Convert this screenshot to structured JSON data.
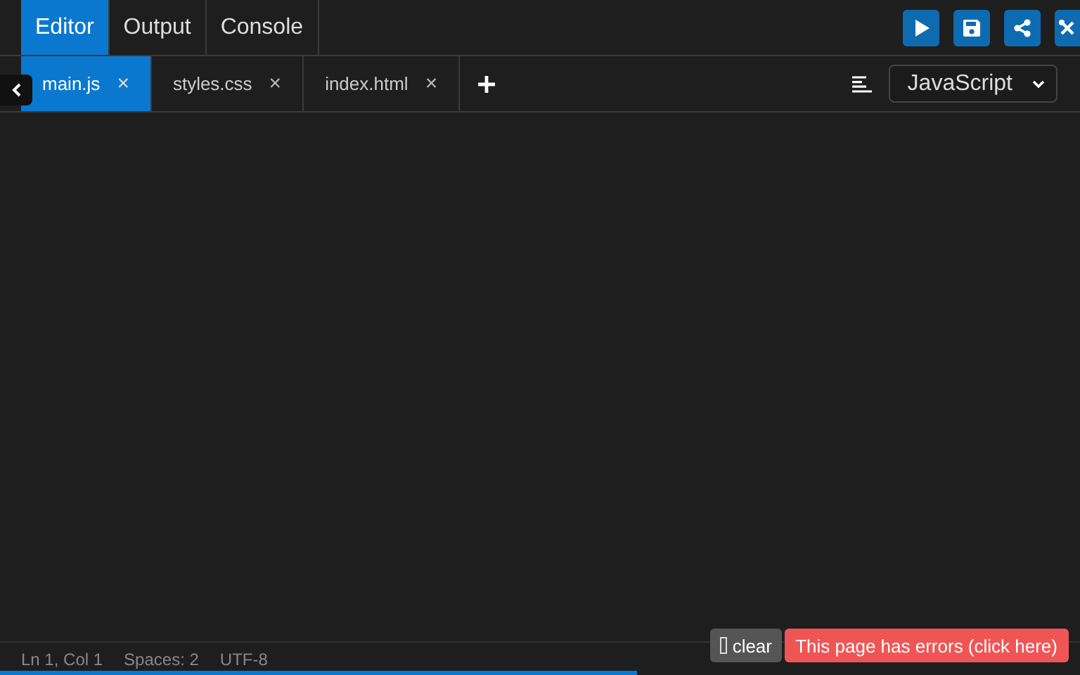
{
  "top_tabs": [
    {
      "label": "Editor",
      "selected": true
    },
    {
      "label": "Output",
      "selected": false
    },
    {
      "label": "Console",
      "selected": false
    }
  ],
  "toolbar_buttons": [
    {
      "kind": "run"
    },
    {
      "kind": "save"
    },
    {
      "kind": "share"
    },
    {
      "kind": "tools"
    }
  ],
  "file_tabs": [
    {
      "label": "main.js",
      "close": "×",
      "selected": true
    },
    {
      "label": "styles.css",
      "close": "×",
      "selected": false
    },
    {
      "label": "index.html",
      "close": "×",
      "selected": false
    }
  ],
  "language": "JavaScript",
  "status_bar": [
    "Ln 1, Col 1",
    "Spaces: 2",
    "UTF-8"
  ],
  "clear_button": "clear",
  "error_button": "This page has errors (click here)",
  "progress": {
    "level": 0.59
  }
}
